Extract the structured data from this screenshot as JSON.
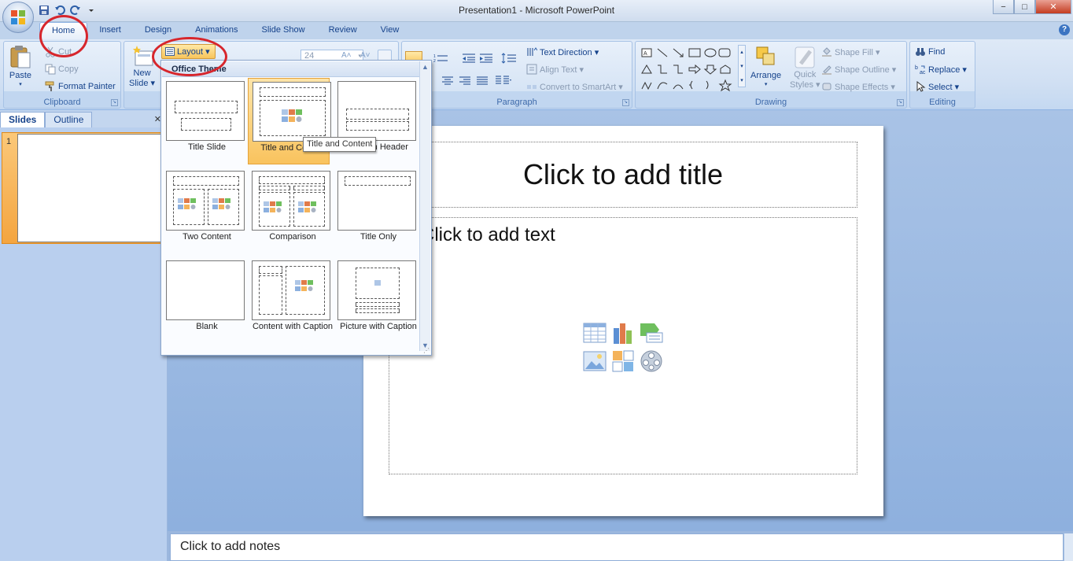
{
  "window": {
    "title": "Presentation1 - Microsoft PowerPoint",
    "minimize": "−",
    "maximize": "□",
    "close": "✕"
  },
  "ribbon_tabs": [
    "Home",
    "Insert",
    "Design",
    "Animations",
    "Slide Show",
    "Review",
    "View"
  ],
  "clipboard": {
    "paste": "Paste",
    "cut": "Cut",
    "copy": "Copy",
    "format_painter": "Format Painter",
    "label": "Clipboard"
  },
  "slides_group": {
    "new_slide_line1": "New",
    "new_slide_line2": "Slide ▾",
    "layout": "Layout ▾"
  },
  "font": {
    "size": "24"
  },
  "paragraph": {
    "text_direction": "Text Direction ▾",
    "align_text": "Align Text ▾",
    "convert_smartart": "Convert to SmartArt ▾",
    "label": "Paragraph"
  },
  "drawing": {
    "arrange": "Arrange",
    "quick_styles_line1": "Quick",
    "quick_styles_line2": "Styles ▾",
    "shape_fill": "Shape Fill ▾",
    "shape_outline": "Shape Outline ▾",
    "shape_effects": "Shape Effects ▾",
    "label": "Drawing"
  },
  "editing": {
    "find": "Find",
    "replace": "Replace ▾",
    "select": "Select ▾",
    "label": "Editing"
  },
  "layout_menu": {
    "header": "Office Theme",
    "items": [
      {
        "label": "Title Slide"
      },
      {
        "label": "Title and Content"
      },
      {
        "label": "Section Header"
      },
      {
        "label": "Two Content"
      },
      {
        "label": "Comparison"
      },
      {
        "label": "Title Only"
      },
      {
        "label": "Blank"
      },
      {
        "label": "Content with Caption"
      },
      {
        "label": "Picture with Caption"
      }
    ],
    "selected_index": 1,
    "tooltip": "Title and Content"
  },
  "slides_pane": {
    "tabs": [
      "Slides",
      "Outline"
    ],
    "close": "✕",
    "slide_number": "1"
  },
  "slide": {
    "title_placeholder": "Click to add title",
    "content_placeholder": "Click to add text"
  },
  "notes": {
    "placeholder": "Click to add notes"
  },
  "colors": {
    "accent": "#15428b",
    "selection": "#f9c35e",
    "annotation": "#d7262c"
  }
}
